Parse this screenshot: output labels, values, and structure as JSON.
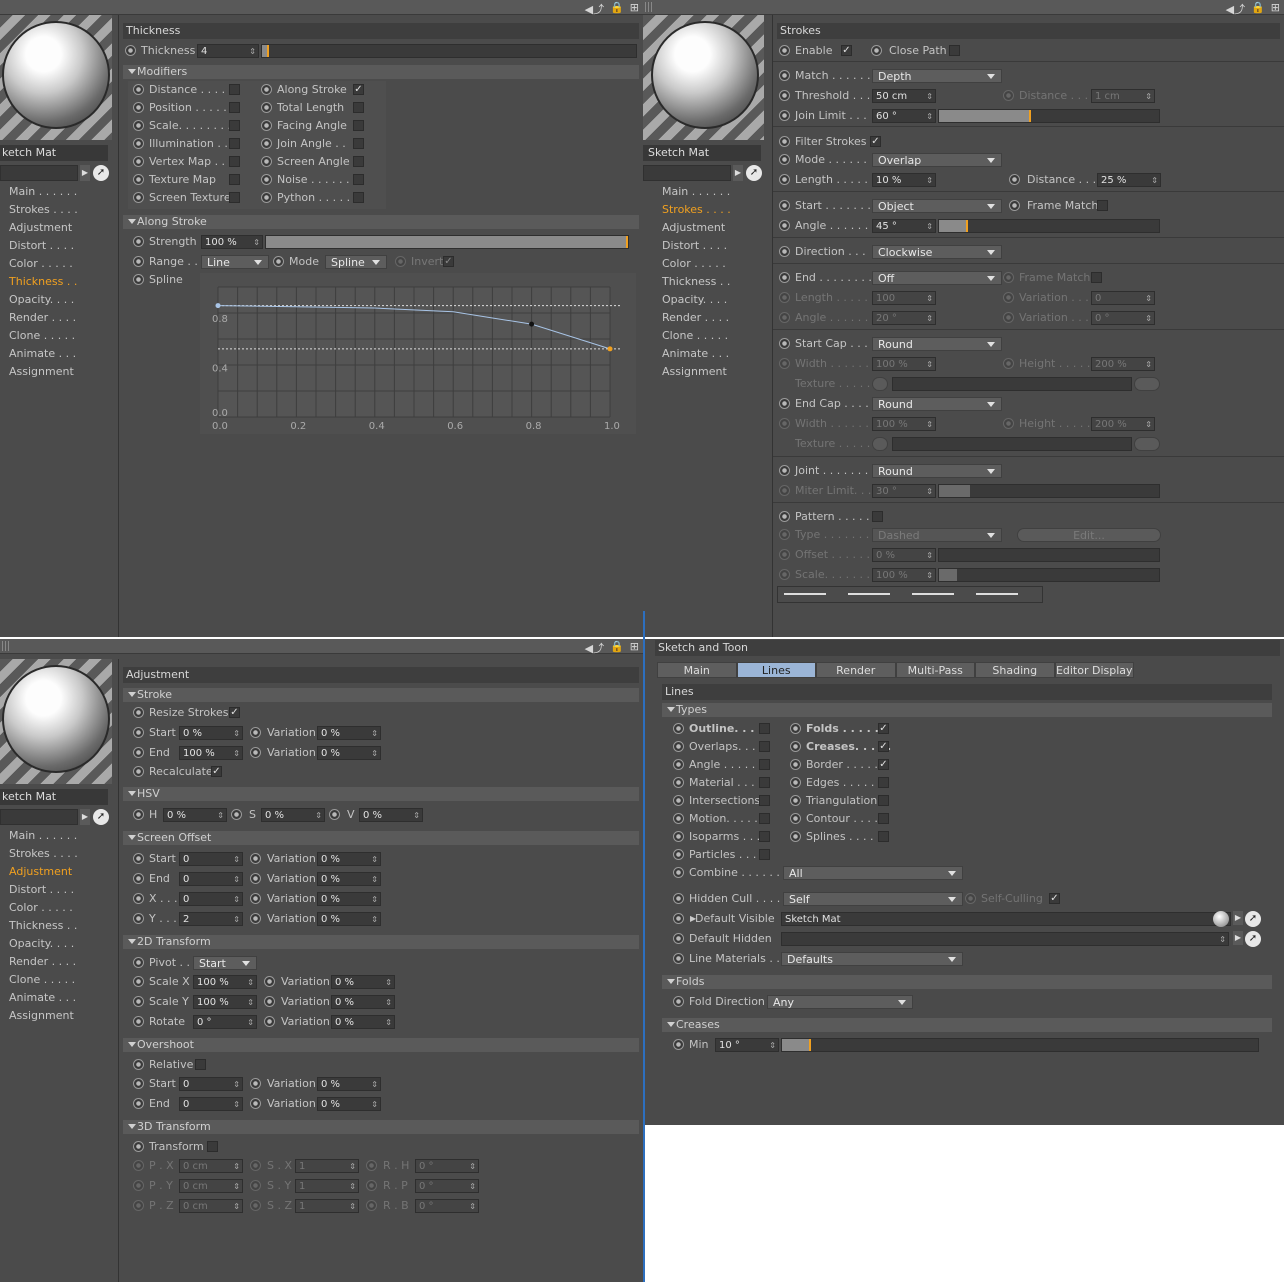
{
  "panel_tl": {
    "side": {
      "material_name": "ketch Mat",
      "nav": [
        "Main . . . . . .",
        "Strokes . . . .",
        "Adjustment",
        "Distort . . . .",
        "Color . . . . .",
        "Thickness . .",
        "Opacity. . . .",
        "Render . . . .",
        "Clone . . . . .",
        "Animate . . .",
        "Assignment"
      ],
      "active": 5
    },
    "title": "Thickness",
    "thickness_label": "Thickness",
    "thickness_value": "4",
    "thickness_fill": 0.02,
    "modifiers_title": "Modifiers",
    "modifiers_left": [
      {
        "label": "Distance . . . . .",
        "checked": false
      },
      {
        "label": "Position . . . . .",
        "checked": false
      },
      {
        "label": "Scale. . . . . . . .",
        "checked": false
      },
      {
        "label": "Illumination . .",
        "checked": false
      },
      {
        "label": "Vertex Map . .",
        "checked": false
      },
      {
        "label": "Texture Map",
        "checked": false
      },
      {
        "label": "Screen Texture",
        "checked": false
      }
    ],
    "modifiers_right": [
      {
        "label": "Along Stroke",
        "checked": true
      },
      {
        "label": "Total Length",
        "checked": false
      },
      {
        "label": "Facing Angle",
        "checked": false
      },
      {
        "label": "Join Angle . .",
        "checked": false
      },
      {
        "label": "Screen Angle",
        "checked": false
      },
      {
        "label": "Noise . . . . . .",
        "checked": false
      },
      {
        "label": "Python . . . . .",
        "checked": false
      }
    ],
    "along_title": "Along Stroke",
    "strength_label": "Strength",
    "strength_value": "100 %",
    "strength_fill": 1.0,
    "range_label": "Range . .",
    "range_value": "Line",
    "mode_label": "Mode",
    "mode_value": "Spline",
    "invert_label": "Invert",
    "check_mark": "✓",
    "spline_label": "Spline",
    "spline_yticks": [
      "0.8",
      "0.4",
      "0.0"
    ],
    "spline_xticks": [
      "0.0",
      "0.2",
      "0.4",
      "0.6",
      "0.8",
      "1.0"
    ],
    "spline_points": [
      [
        0,
        0.9
      ],
      [
        0.2,
        0.89
      ],
      [
        0.4,
        0.88
      ],
      [
        0.6,
        0.85
      ],
      [
        0.8,
        0.75
      ],
      [
        1.0,
        0.55
      ]
    ]
  },
  "panel_tr": {
    "side": {
      "material_name": "Sketch Mat",
      "nav": [
        "Main . . . . . .",
        "Strokes . . . .",
        "Adjustment",
        "Distort . . . .",
        "Color . . . . .",
        "Thickness . .",
        "Opacity. . . .",
        "Render . . . .",
        "Clone . . . . .",
        "Animate . . .",
        "Assignment"
      ],
      "active": 1
    },
    "title": "Strokes",
    "enable": "Enable",
    "close_path": "Close Path",
    "match": "Match . . . . . .",
    "match_value": "Depth",
    "threshold": "Threshold . . .",
    "threshold_value": "50 cm",
    "distance": "Distance . . . .",
    "distance_value": "1 cm",
    "join_limit": "Join Limit . . .",
    "join_limit_value": "60 °",
    "join_fill": 0.42,
    "filter_strokes": "Filter Strokes",
    "mode": "Mode . . . . . .",
    "mode_value": "Overlap",
    "length": "Length . . . . .",
    "length_value": "10 %",
    "distance2": "Distance . . . .",
    "distance2_value": "25 %",
    "start": "Start . . . . . . .",
    "start_value": "Object",
    "frame_match": "Frame Match",
    "angle": "Angle . . . . . .",
    "angle_value": "45 °",
    "angle_fill": 0.13,
    "direction": "Direction . . .",
    "direction_value": "Clockwise",
    "end": "End . . . . . . . .",
    "end_value": "Off",
    "frame_match2": "Frame Match",
    "length2": "Length . . . . . .",
    "length2_value": "100",
    "variation": "Variation . . .",
    "variation_value": "0",
    "angle2": "Angle . . . . . .",
    "angle2_value": "20 °",
    "variation2": "Variation . . .",
    "variation2_value": "0 °",
    "start_cap": "Start Cap . . .",
    "start_cap_value": "Round",
    "width": "Width . . . . . .",
    "width_value": "100 %",
    "height": "Height . . . . .",
    "height_value": "200 %",
    "texture": "Texture . . . . .",
    "end_cap": "End Cap . . . .",
    "end_cap_value": "Round",
    "width2": "Width . . . . . .",
    "width2_value": "100 %",
    "height2": "Height . . . . .",
    "height2_value": "200 %",
    "texture2": "Texture . . . . .",
    "joint": "Joint . . . . . . .",
    "joint_value": "Round",
    "miter": "Miter Limit. . .",
    "miter_value": "30 °",
    "miter_fill": 0.14,
    "pattern": "Pattern . . . . .",
    "type": "Type . . . . . . .",
    "type_value": "Dashed",
    "edit": "Edit...",
    "offset": "Offset . . . . . .",
    "offset_value": "0 %",
    "scale": "Scale. . . . . . .",
    "scale_value": "100 %",
    "scale_fill": 0.08
  },
  "panel_bl": {
    "side": {
      "material_name": "ketch Mat",
      "nav": [
        "Main . . . . . .",
        "Strokes . . . .",
        "Adjustment",
        "Distort . . . .",
        "Color . . . . .",
        "Thickness . .",
        "Opacity. . . .",
        "Render . . . .",
        "Clone . . . . .",
        "Animate . . .",
        "Assignment"
      ],
      "active": 2
    },
    "title": "Adjustment",
    "stroke": "Stroke",
    "resize": "Resize Strokes",
    "start": "Start",
    "start_value": "0 %",
    "variation": "Variation",
    "var0": "0 %",
    "end": "End",
    "end_value": "100 %",
    "recalculate": "Recalculate",
    "hsv": "HSV",
    "h": "H",
    "h_value": "0 %",
    "s": "S",
    "s_value": "0 %",
    "v": "V",
    "v_value": "0 %",
    "screen_offset": "Screen Offset",
    "so_start": "0",
    "so_end": "0",
    "x": "X . . .",
    "x_value": "0",
    "y": "Y . . .",
    "y_value": "2",
    "t2d": "2D Transform",
    "pivot": "Pivot . . .",
    "pivot_value": "Start",
    "scale_x": "Scale X",
    "scale_x_value": "100 %",
    "scale_y": "Scale Y",
    "scale_y_value": "100 %",
    "rotate": "Rotate",
    "rotate_value": "0 °",
    "overshoot": "Overshoot",
    "relative": "Relative",
    "t3d": "3D Transform",
    "transform": "Transform",
    "px": "P . X",
    "py": "P . Y",
    "pz": "P . Z",
    "p_value": "0 cm",
    "sx": "S . X",
    "sy": "S . Y",
    "sz": "S . Z",
    "s1": "1",
    "rh": "R . H",
    "rp": "R . P",
    "rb": "R . B",
    "r0": "0 °"
  },
  "panel_br": {
    "title": "Sketch and Toon",
    "tabs": [
      "Main",
      "Lines",
      "Render",
      "Multi-Pass",
      "Shading",
      "Editor Display"
    ],
    "active_tab": 1,
    "lines": "Lines",
    "types": "Types",
    "left": [
      {
        "label": "Outline. . . .",
        "checked": false,
        "bold": true
      },
      {
        "label": "Overlaps. . . .",
        "checked": false
      },
      {
        "label": "Angle . . . . . .",
        "checked": false
      },
      {
        "label": "Material . . . .",
        "checked": false
      },
      {
        "label": "Intersections",
        "checked": false
      },
      {
        "label": "Motion. . . . . .",
        "checked": false
      },
      {
        "label": "Isoparms . . .",
        "checked": false
      },
      {
        "label": "Particles . . .",
        "checked": false
      }
    ],
    "right": [
      {
        "label": "Folds . . . . . .",
        "checked": true,
        "bold": true
      },
      {
        "label": "Creases. . . . .",
        "checked": true,
        "bold": true
      },
      {
        "label": "Border . . . . .",
        "checked": true
      },
      {
        "label": "Edges . . . . .",
        "checked": false
      },
      {
        "label": "Triangulation",
        "checked": false
      },
      {
        "label": "Contour . . . .",
        "checked": false
      },
      {
        "label": "Splines . . . . .",
        "checked": false
      }
    ],
    "combine": "Combine . . . . . .",
    "combine_value": "All",
    "hidden_cull": "Hidden Cull . . . .",
    "hidden_cull_value": "Self",
    "self_culling": "Self-Culling",
    "default_visible": "Default Visible",
    "default_visible_value": "Sketch Mat",
    "default_hidden": "Default Hidden",
    "line_materials": "Line Materials . .",
    "line_materials_value": "Defaults",
    "folds": "Folds",
    "fold_direction": "Fold Direction",
    "fold_direction_value": "Any",
    "creases": "Creases",
    "min": "Min",
    "min_value": "10 °",
    "min_fill": 0.06
  }
}
